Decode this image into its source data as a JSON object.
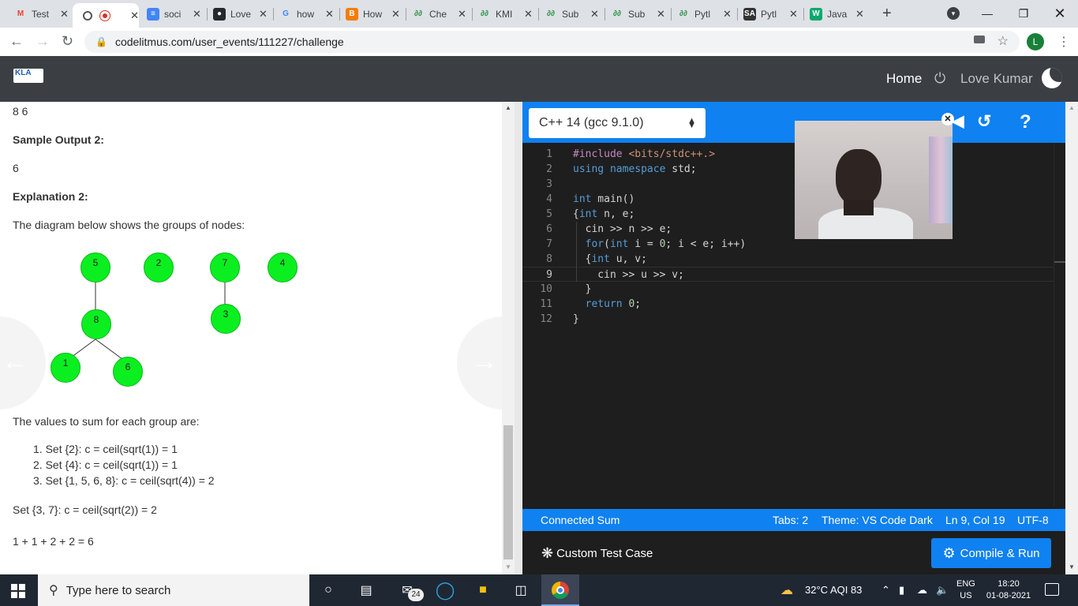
{
  "browser": {
    "tabs": [
      {
        "title": "Test",
        "icon": "gmail-icon",
        "color": "#ea4335"
      },
      {
        "title": "",
        "icon": "recording-icon",
        "color": "#d93025",
        "active": true
      },
      {
        "title": "soci",
        "icon": "google-docs-icon",
        "color": "#4285f4"
      },
      {
        "title": "Love",
        "icon": "github-icon",
        "color": "#24292e"
      },
      {
        "title": "how",
        "icon": "google-icon",
        "color": "#4285f4"
      },
      {
        "title": "How",
        "icon": "blogger-icon",
        "color": "#f57d00"
      },
      {
        "title": "Che",
        "icon": "geeksforgeeks-icon",
        "color": "#2f8d46"
      },
      {
        "title": "KMI",
        "icon": "geeksforgeeks-icon",
        "color": "#2f8d46"
      },
      {
        "title": "Sub",
        "icon": "geeksforgeeks-icon",
        "color": "#2f8d46"
      },
      {
        "title": "Sub",
        "icon": "geeksforgeeks-icon",
        "color": "#2f8d46"
      },
      {
        "title": "Pytl",
        "icon": "geeksforgeeks-icon",
        "color": "#2f8d46"
      },
      {
        "title": "Pytl",
        "icon": "sa-icon",
        "color": "#333333"
      },
      {
        "title": "Java",
        "icon": "w3-icon",
        "color": "#04aa6d"
      }
    ],
    "new_tab": "+",
    "url": "codelitmus.com/user_events/111227/challenge",
    "profile_initial": "L"
  },
  "site": {
    "logo_text": "KLA",
    "nav_home": "Home",
    "nav_user": "Love Kumar"
  },
  "problem": {
    "input_line": "8 6",
    "sample_output_heading": "Sample Output 2:",
    "sample_output_value": "6",
    "explanation_heading": "Explanation 2:",
    "diagram_caption": "The diagram below shows the groups of nodes:",
    "nodes": [
      "5",
      "2",
      "7",
      "4",
      "8",
      "3",
      "1",
      "6"
    ],
    "sum_intro": "The values to sum for each group are:",
    "groups": [
      "1. Set {2}: c = ceil(sqrt(1)) = 1",
      "2. Set {4}: c = ceil(sqrt(1)) = 1",
      "3. Set {1, 5, 6, 8}: c = ceil(sqrt(4)) = 2"
    ],
    "extra_set": "Set {3, 7}: c = ceil(sqrt(2)) = 2",
    "total": "1 + 1 + 2 + 2 = 6"
  },
  "editor": {
    "language": "C++ 14 (gcc 9.1.0)",
    "code_lines": [
      {
        "n": "1",
        "text": "#include <bits/stdc++.>"
      },
      {
        "n": "2",
        "text": "using namespace std;"
      },
      {
        "n": "3",
        "text": ""
      },
      {
        "n": "4",
        "text": "int main()"
      },
      {
        "n": "5",
        "text": "{int n, e;"
      },
      {
        "n": "6",
        "text": "  cin >> n >> e;"
      },
      {
        "n": "7",
        "text": "  for(int i = 0; i < e; i++)"
      },
      {
        "n": "8",
        "text": "  {int u, v;"
      },
      {
        "n": "9",
        "text": "    cin >> u >> v;"
      },
      {
        "n": "10",
        "text": "  }"
      },
      {
        "n": "11",
        "text": "  return 0;"
      },
      {
        "n": "12",
        "text": "}"
      }
    ],
    "status_left": "Connected Sum",
    "status_tabs": "Tabs: 2",
    "status_theme": "Theme: VS Code Dark",
    "status_pos": "Ln 9, Col 19",
    "status_enc": "UTF-8",
    "custom_test_label": "Custom Test Case",
    "compile_label": "Compile & Run"
  },
  "taskbar": {
    "search_placeholder": "Type here to search",
    "mail_badge": "24",
    "weather": "32°C  AQI 83",
    "lang_top": "ENG",
    "lang_bottom": "US",
    "time": "18:20",
    "date": "01-08-2021"
  }
}
